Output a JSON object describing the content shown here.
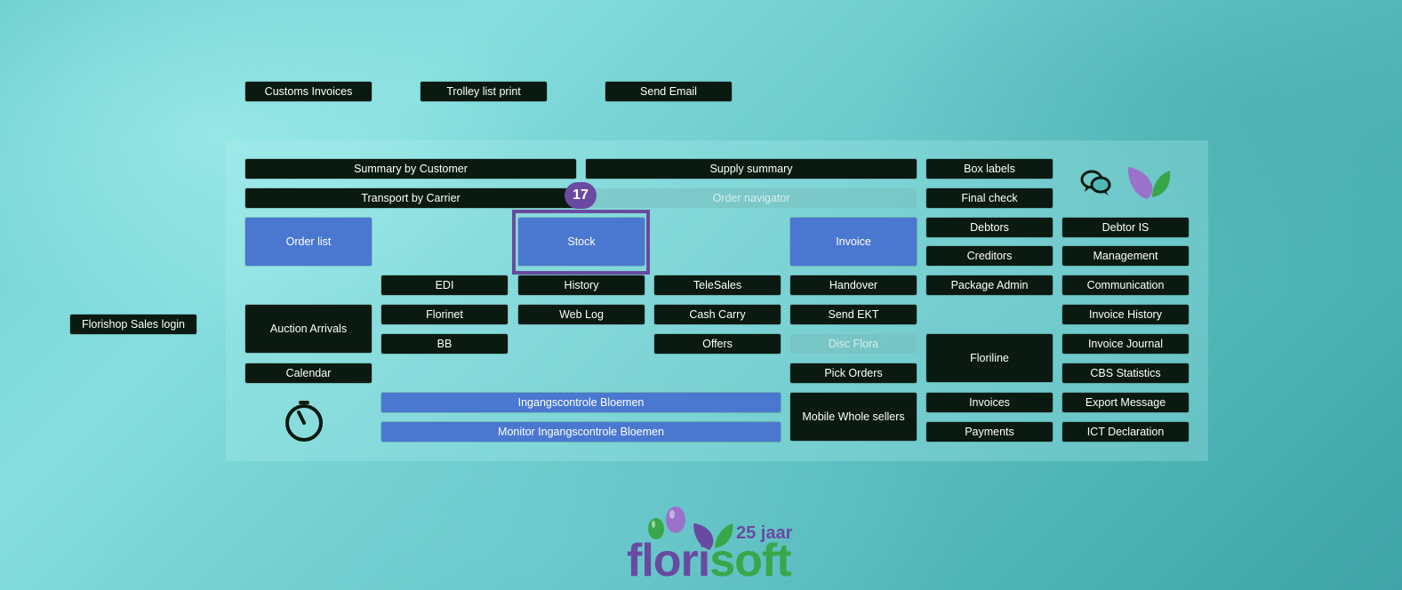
{
  "top_buttons": {
    "customs_invoices": "Customs Invoices",
    "trolley_list_print": "Trolley list print",
    "send_email": "Send Email"
  },
  "sales_login": "Florishop Sales login",
  "panel": {
    "summary_by_customer": "Summary by Customer",
    "supply_summary": "Supply summary",
    "box_labels": "Box labels",
    "transport_by_carrier": "Transport by Carrier",
    "order_navigator": "Order navigator",
    "final_check": "Final check",
    "order_list": "Order list",
    "stock": "Stock",
    "invoice": "Invoice",
    "debtors": "Debtors",
    "debtor_is": "Debtor IS",
    "creditors": "Creditors",
    "management": "Management",
    "edi": "EDI",
    "history": "History",
    "telesales": "TeleSales",
    "handover": "Handover",
    "package_admin": "Package Admin",
    "communication": "Communication",
    "auction_arrivals": "Auction Arrivals",
    "florinet": "Florinet",
    "web_log": "Web Log",
    "cash_carry": "Cash Carry",
    "send_ekt": "Send EKT",
    "invoice_history": "Invoice History",
    "bb": "BB",
    "offers": "Offers",
    "disc_flora": "Disc Flora",
    "floriline": "Floriline",
    "invoice_journal": "Invoice Journal",
    "calendar": "Calendar",
    "pick_orders": "Pick Orders",
    "cbs_statistics": "CBS Statistics",
    "ingangscontrole_bloemen": "Ingangscontrole Bloemen",
    "mobile_whole_sellers": "Mobile Whole sellers",
    "invoices": "Invoices",
    "export_message": "Export Message",
    "monitor_ingangscontrole_bloemen": "Monitor Ingangscontrole Bloemen",
    "payments": "Payments",
    "ict_declaration": "ICT Declaration"
  },
  "step_badge": "17",
  "logo": {
    "flori": "flori",
    "soft": "soft",
    "anniversary": "25 jaar"
  },
  "colors": {
    "button_dark": "#0a1a10",
    "button_blue": "#4a78d0",
    "highlight_purple": "#6a4aa0",
    "logo_green": "#3aa64a"
  },
  "icons": [
    "chat-bubbles-icon",
    "leaf-logo-icon",
    "timer-icon",
    "balloons-icon"
  ]
}
